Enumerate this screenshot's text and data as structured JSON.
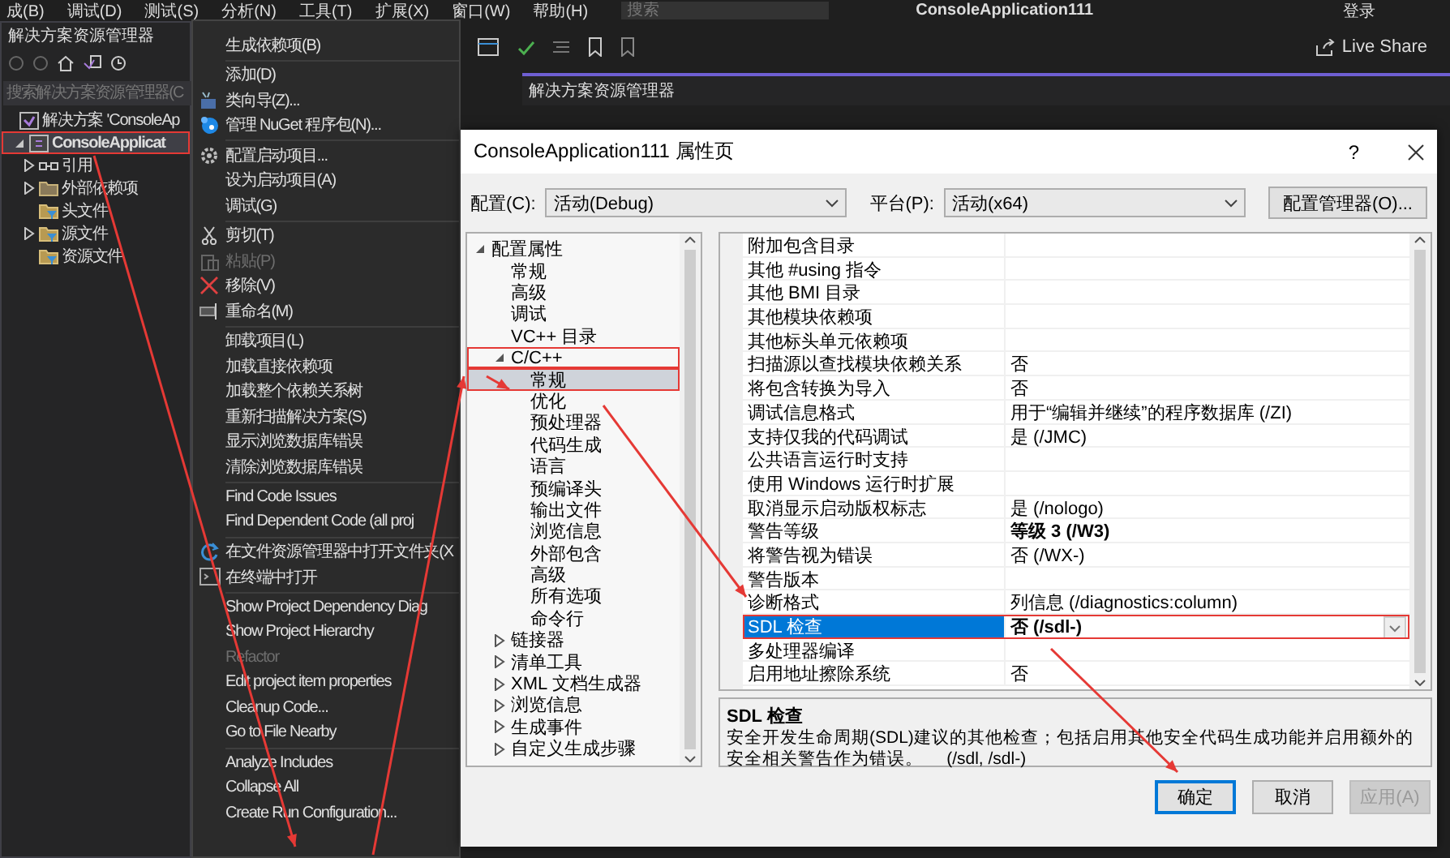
{
  "menu_bar": {
    "items": [
      "成(B)",
      "调试(D)",
      "测试(S)",
      "分析(N)",
      "工具(T)",
      "扩展(X)",
      "窗口(W)",
      "帮助(H)"
    ],
    "search": {
      "placeholder": "搜索"
    },
    "title": "ConsoleApplication111",
    "sign_in": "登录"
  },
  "toolbar": {
    "live_share": "Live Share"
  },
  "solution_explorer": {
    "title": "解决方案资源管理器",
    "search": {
      "placeholder": "搜索解决方案资源管理器(C"
    },
    "tree": [
      {
        "label": "解决方案 'ConsoleAp",
        "kind": "solution",
        "selected": false,
        "outlined": false,
        "children": [
          {
            "label": "ConsoleApplicat",
            "kind": "project",
            "expanded": true,
            "selected": true,
            "outlined": true,
            "children": [
              {
                "label": "引用",
                "kind": "references",
                "expanded": false,
                "selected": false,
                "outlined": false
              },
              {
                "label": "外部依赖项",
                "kind": "folder",
                "expanded": false,
                "selected": false,
                "outlined": false
              },
              {
                "label": "头文件",
                "kind": "filter",
                "selected": false,
                "outlined": false
              },
              {
                "label": "源文件",
                "kind": "filter",
                "expanded": false,
                "selected": false,
                "outlined": false
              },
              {
                "label": "资源文件",
                "kind": "filter",
                "selected": false,
                "outlined": false
              }
            ]
          }
        ]
      }
    ]
  },
  "right_panel": {
    "title": "解决方案资源管理器"
  },
  "context_menu": {
    "sections": [
      [
        {
          "label": "生成依赖项(B)",
          "disabled": false
        }
      ],
      [
        {
          "label": "添加(D)",
          "disabled": false
        },
        {
          "label": "类向导(Z)...",
          "disabled": false
        },
        {
          "label": "管理 NuGet 程序包(N)...",
          "disabled": false
        }
      ],
      [
        {
          "label": "配置启动项目...",
          "disabled": false
        },
        {
          "label": "设为启动项目(A)",
          "disabled": false
        },
        {
          "label": "调试(G)",
          "disabled": false
        }
      ],
      [
        {
          "label": "剪切(T)",
          "disabled": false
        },
        {
          "label": "粘贴(P)",
          "disabled": true
        },
        {
          "label": "移除(V)",
          "disabled": false
        },
        {
          "label": "重命名(M)",
          "disabled": false
        }
      ],
      [
        {
          "label": "卸载项目(L)",
          "disabled": false
        },
        {
          "label": "加载直接依赖项",
          "disabled": false
        },
        {
          "label": "加载整个依赖关系树",
          "disabled": false
        },
        {
          "label": "重新扫描解决方案(S)",
          "disabled": false
        },
        {
          "label": "显示浏览数据库错误",
          "disabled": false
        },
        {
          "label": "清除浏览数据库错误",
          "disabled": false
        }
      ],
      [
        {
          "label": "Find Code Issues",
          "disabled": false
        },
        {
          "label": "Find Dependent Code (all proj",
          "disabled": false
        }
      ],
      [
        {
          "label": "在文件资源管理器中打开文件夹(X",
          "disabled": false
        },
        {
          "label": "在终端中打开",
          "disabled": false
        }
      ],
      [
        {
          "label": "Show Project Dependency Diag",
          "disabled": false
        },
        {
          "label": "Show Project Hierarchy",
          "disabled": false
        },
        {
          "label": "Refactor",
          "disabled": true
        },
        {
          "label": "Edit project item properties",
          "disabled": false
        },
        {
          "label": "Cleanup Code...",
          "disabled": false
        },
        {
          "label": "Go to File Nearby",
          "disabled": false
        }
      ],
      [
        {
          "label": "Analyze Includes",
          "disabled": false
        },
        {
          "label": "Collapse All",
          "disabled": false
        },
        {
          "label": "Create Run Configuration...",
          "disabled": false
        }
      ]
    ]
  },
  "dialog": {
    "title": "ConsoleApplication111 属性页",
    "help": "?",
    "configuration": {
      "label": "配置(C):",
      "value": "活动(Debug)"
    },
    "platform": {
      "label": "平台(P):",
      "value": "活动(x64)"
    },
    "config_manager_button": "配置管理器(O)...",
    "tree": [
      {
        "label": "配置属性",
        "expanded": true,
        "selected": false,
        "outlined": false,
        "children": [
          {
            "label": "常规",
            "selected": false,
            "outlined": false
          },
          {
            "label": "高级",
            "selected": false,
            "outlined": false
          },
          {
            "label": "调试",
            "selected": false,
            "outlined": false
          },
          {
            "label": "VC++ 目录",
            "selected": false,
            "outlined": false
          },
          {
            "label": "C/C++",
            "expanded": true,
            "selected": false,
            "outlined": true,
            "children": [
              {
                "label": "常规",
                "selected": true,
                "outlined": true
              },
              {
                "label": "优化",
                "selected": false,
                "outlined": false
              },
              {
                "label": "预处理器",
                "selected": false,
                "outlined": false
              },
              {
                "label": "代码生成",
                "selected": false,
                "outlined": false
              },
              {
                "label": "语言",
                "selected": false,
                "outlined": false
              },
              {
                "label": "预编译头",
                "selected": false,
                "outlined": false
              },
              {
                "label": "输出文件",
                "selected": false,
                "outlined": false
              },
              {
                "label": "浏览信息",
                "selected": false,
                "outlined": false
              },
              {
                "label": "外部包含",
                "selected": false,
                "outlined": false
              },
              {
                "label": "高级",
                "selected": false,
                "outlined": false
              },
              {
                "label": "所有选项",
                "selected": false,
                "outlined": false
              },
              {
                "label": "命令行",
                "selected": false,
                "outlined": false
              }
            ]
          },
          {
            "label": "链接器",
            "expanded": false,
            "selected": false,
            "outlined": false
          },
          {
            "label": "清单工具",
            "expanded": false,
            "selected": false,
            "outlined": false
          },
          {
            "label": "XML 文档生成器",
            "expanded": false,
            "selected": false,
            "outlined": false
          },
          {
            "label": "浏览信息",
            "expanded": false,
            "selected": false,
            "outlined": false
          },
          {
            "label": "生成事件",
            "expanded": false,
            "selected": false,
            "outlined": false
          },
          {
            "label": "自定义生成步骤",
            "expanded": false,
            "selected": false,
            "outlined": false
          }
        ]
      }
    ],
    "properties": [
      {
        "name": "附加包含目录",
        "selected": false,
        "outlined": false
      },
      {
        "name": "其他 #using 指令",
        "selected": false,
        "outlined": false
      },
      {
        "name": "其他 BMI 目录",
        "selected": false,
        "outlined": false
      },
      {
        "name": "其他模块依赖项",
        "selected": false,
        "outlined": false
      },
      {
        "name": "其他标头单元依赖项",
        "selected": false,
        "outlined": false
      },
      {
        "name": "扫描源以查找模块依赖关系",
        "value": "否",
        "modified": false,
        "selected": false,
        "outlined": false
      },
      {
        "name": "将包含转换为导入",
        "value": "否",
        "modified": false,
        "selected": false,
        "outlined": false
      },
      {
        "name": "调试信息格式",
        "value": "用于“编辑并继续”的程序数据库 (/ZI)",
        "modified": false,
        "selected": false,
        "outlined": false
      },
      {
        "name": "支持仅我的代码调试",
        "value": "是 (/JMC)",
        "modified": false,
        "selected": false,
        "outlined": false
      },
      {
        "name": "公共语言运行时支持",
        "selected": false,
        "outlined": false
      },
      {
        "name": "使用 Windows 运行时扩展",
        "selected": false,
        "outlined": false
      },
      {
        "name": "取消显示启动版权标志",
        "value": "是 (/nologo)",
        "modified": false,
        "selected": false,
        "outlined": false
      },
      {
        "name": "警告等级",
        "value": "等级 3 (/W3)",
        "modified": true,
        "selected": false,
        "outlined": false
      },
      {
        "name": "将警告视为错误",
        "value": "否 (/WX-)",
        "modified": false,
        "selected": false,
        "outlined": false
      },
      {
        "name": "警告版本",
        "selected": false,
        "outlined": false
      },
      {
        "name": "诊断格式",
        "value": "列信息 (/diagnostics:column)",
        "modified": false,
        "selected": false,
        "outlined": false
      },
      {
        "name": "SDL 检查",
        "value": "否 (/sdl-)",
        "modified": true,
        "selected": true,
        "outlined": true
      },
      {
        "name": "多处理器编译",
        "selected": false,
        "outlined": false
      },
      {
        "name": "启用地址擦除系统",
        "value": "否",
        "modified": false,
        "selected": false,
        "outlined": false
      }
    ],
    "description": {
      "title": "SDL 检查",
      "text": "安全开发生命周期(SDL)建议的其他检查；包括启用其他安全代码生成功能并启用额外的安全相关警告作为错误。     (/sdl, /sdl-)"
    },
    "buttons": [
      {
        "label": "确定",
        "kind": "default",
        "disabled": false
      },
      {
        "label": "取消",
        "kind": "normal",
        "disabled": false
      },
      {
        "label": "应用(A)",
        "kind": "normal",
        "disabled": true
      }
    ]
  }
}
